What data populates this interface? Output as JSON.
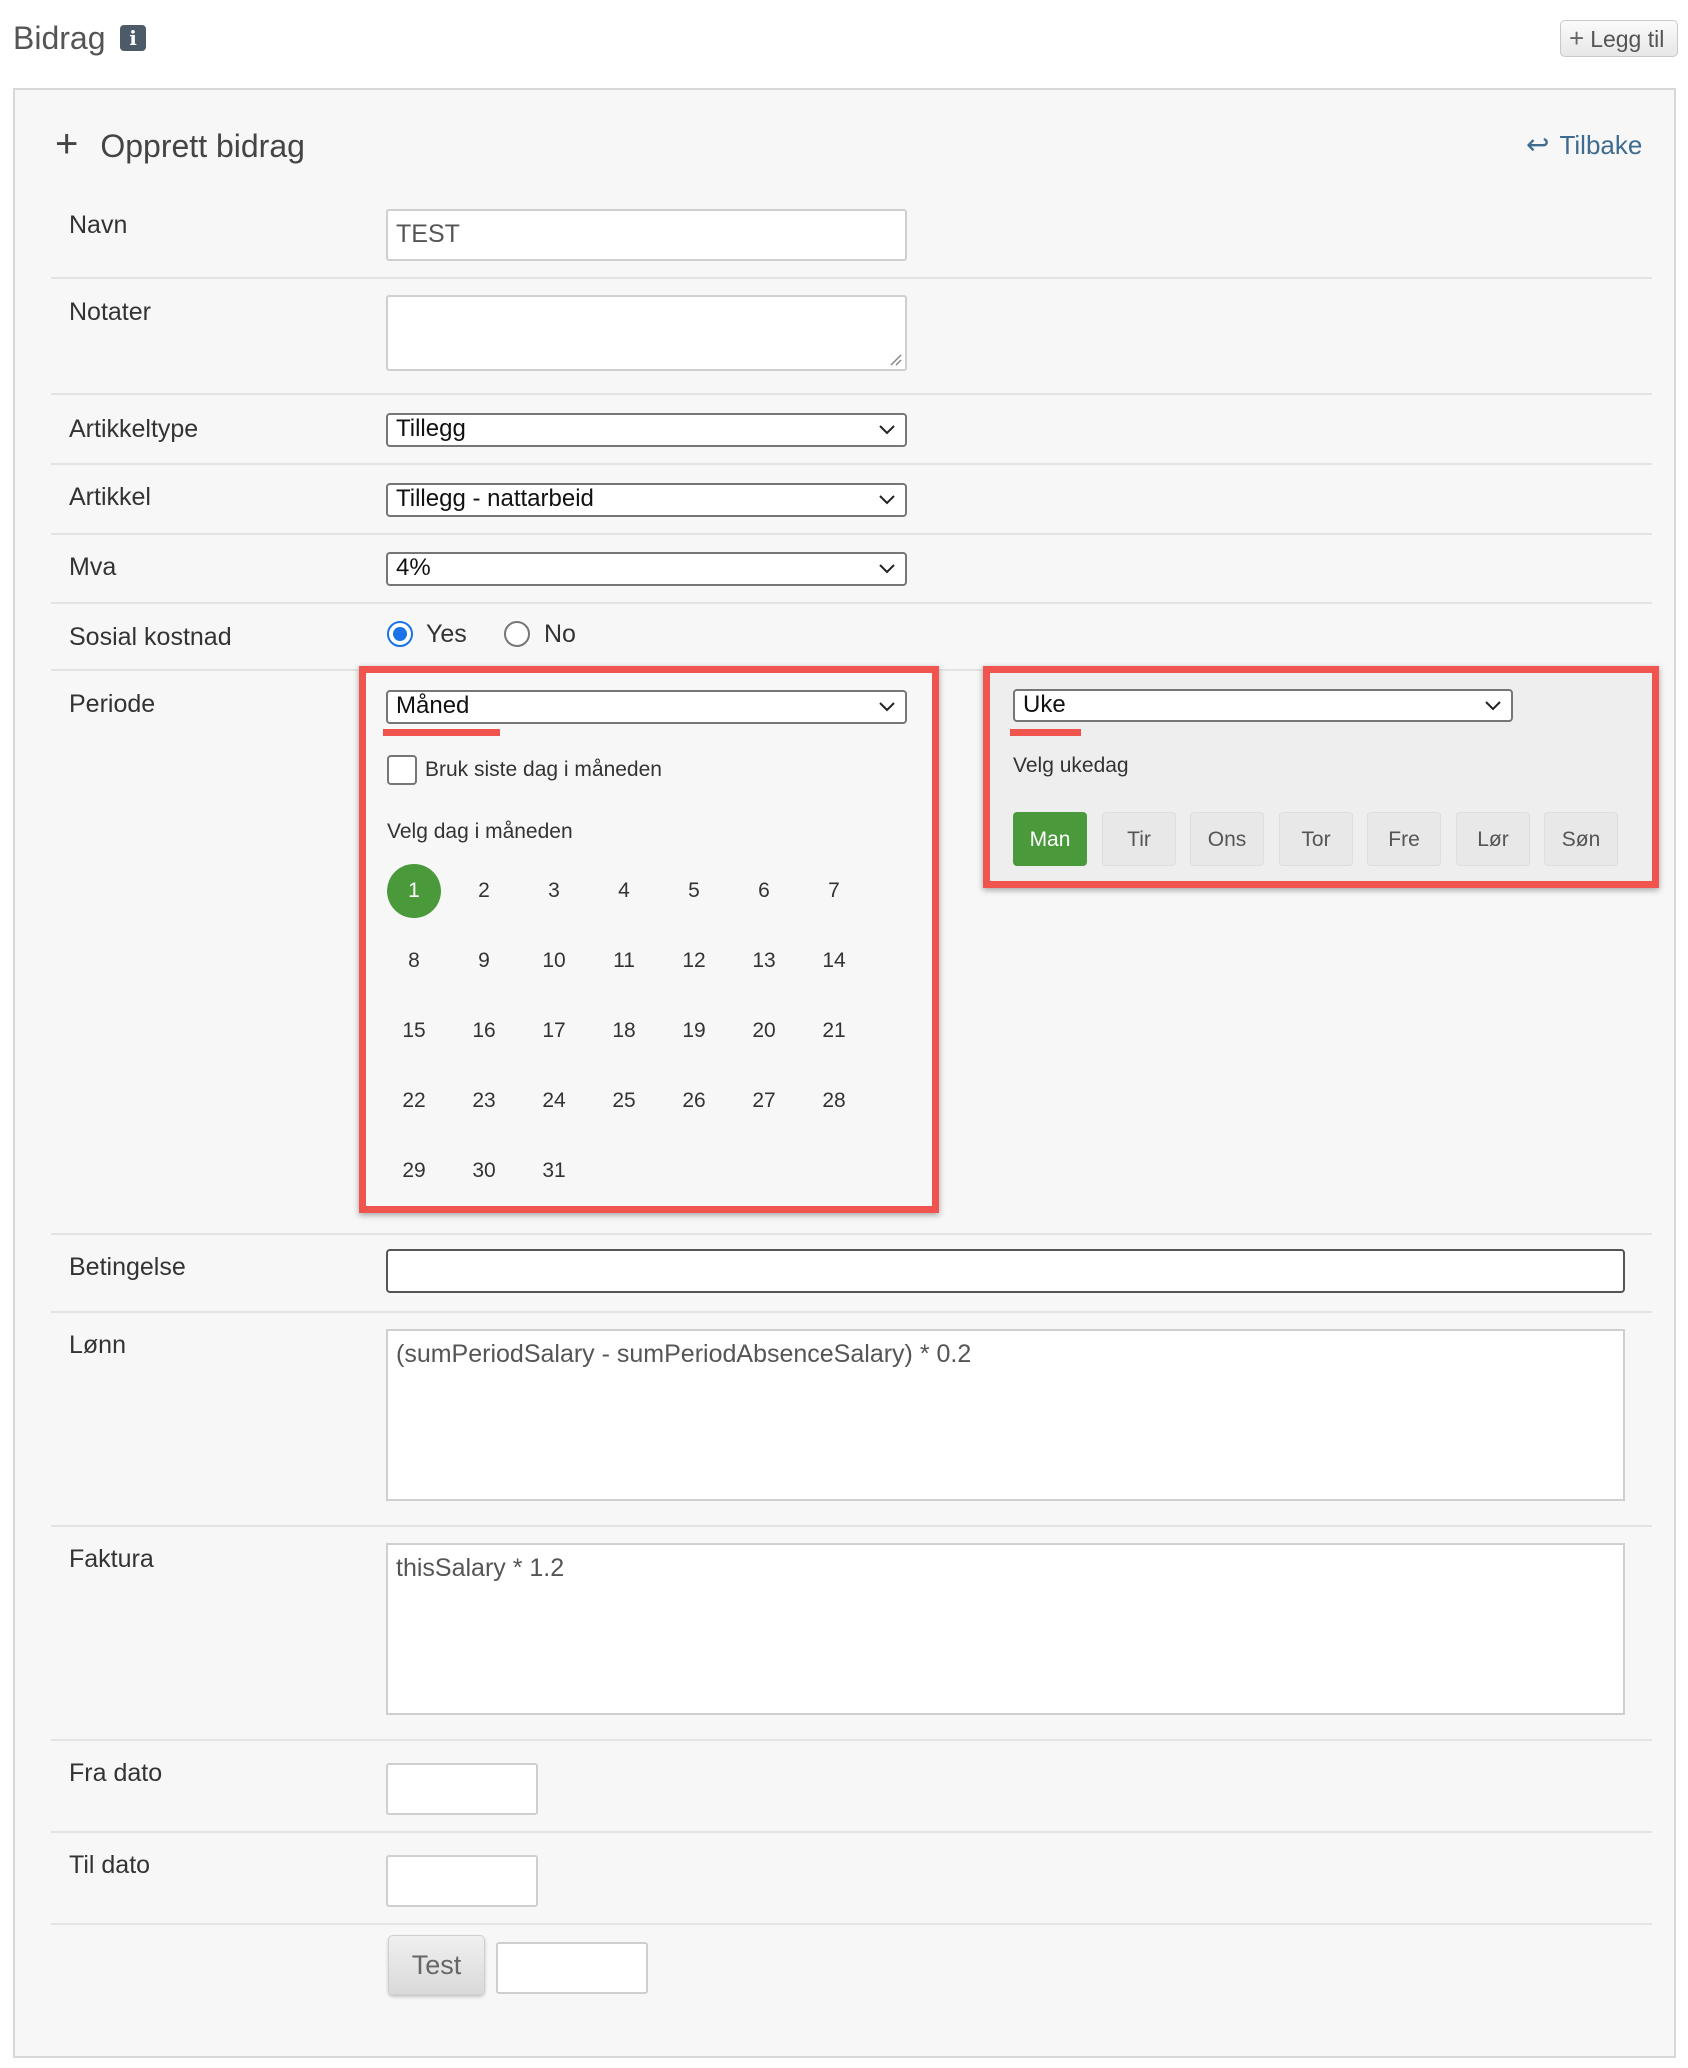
{
  "header": {
    "title": "Bidrag",
    "info_icon": "info-icon",
    "add_label": "Legg til"
  },
  "form": {
    "title": "Opprett bidrag",
    "back_label": "Tilbake",
    "navn": {
      "label": "Navn",
      "value": "TEST"
    },
    "notater": {
      "label": "Notater",
      "value": ""
    },
    "artikkeltype": {
      "label": "Artikkeltype",
      "value": "Tillegg"
    },
    "artikkel": {
      "label": "Artikkel",
      "value": "Tillegg - nattarbeid"
    },
    "mva": {
      "label": "Mva",
      "value": "4%"
    },
    "sosial": {
      "label": "Sosial kostnad",
      "yes": "Yes",
      "no": "No",
      "selected": "Yes"
    },
    "periode": {
      "label": "Periode",
      "month": {
        "select_value": "Måned",
        "last_day_label": "Bruk siste dag i måneden",
        "last_day_checked": false,
        "day_prompt": "Velg dag i måneden",
        "days": [
          "1",
          "2",
          "3",
          "4",
          "5",
          "6",
          "7",
          "8",
          "9",
          "10",
          "11",
          "12",
          "13",
          "14",
          "15",
          "16",
          "17",
          "18",
          "19",
          "20",
          "21",
          "22",
          "23",
          "24",
          "25",
          "26",
          "27",
          "28",
          "29",
          "30",
          "31"
        ],
        "selected_day": "1"
      },
      "week": {
        "select_value": "Uke",
        "day_prompt": "Velg ukedag",
        "weekdays": [
          "Man",
          "Tir",
          "Ons",
          "Tor",
          "Fre",
          "Lør",
          "Søn"
        ],
        "selected_weekday": "Man"
      }
    },
    "betingelse": {
      "label": "Betingelse",
      "value": ""
    },
    "lonn": {
      "label": "Lønn",
      "value": "(sumPeriodSalary - sumPeriodAbsenceSalary) * 0.2"
    },
    "faktura": {
      "label": "Faktura",
      "value": "thisSalary * 1.2"
    },
    "fra_dato": {
      "label": "Fra dato",
      "value": ""
    },
    "til_dato": {
      "label": "Til dato",
      "value": ""
    },
    "test_label": "Test",
    "test_result": ""
  },
  "colors": {
    "accent_green": "#4a9a3c",
    "highlight_red": "#f0544f",
    "link_blue": "#3e6b8f",
    "radio_blue": "#1a73e8"
  }
}
